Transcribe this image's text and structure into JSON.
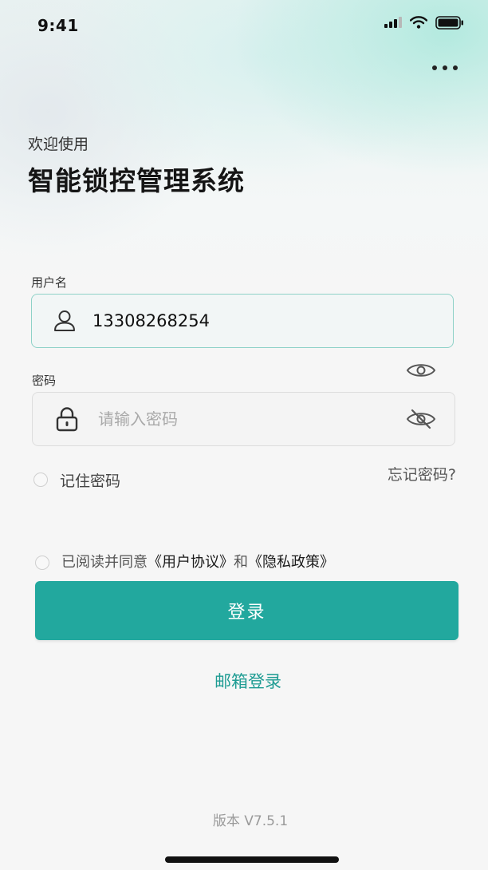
{
  "status_bar": {
    "time": "9:41",
    "icons": [
      "signal-icon",
      "wifi-icon",
      "battery-icon"
    ]
  },
  "header": {
    "more_icon": "more-horizontal-icon"
  },
  "welcome": {
    "subtitle": "欢迎使用",
    "title": "智能锁控管理系统"
  },
  "login_form": {
    "username": {
      "label": "用户名",
      "value": "13308268254",
      "icon": "user-icon"
    },
    "password": {
      "label": "密码",
      "value": "",
      "placeholder": "请输入密码",
      "icon": "lock-icon",
      "show_icon": "eye-icon",
      "hide_icon": "eye-off-icon"
    },
    "remember_label": "记住密码",
    "forgot_link": "忘记密码?",
    "agreement": {
      "prefix": "已阅读并同意",
      "user_agreement": "《用户协议》",
      "conjunction": "和",
      "privacy_policy": "《隐私政策》"
    },
    "login_button": "登录",
    "email_login": "邮箱登录"
  },
  "footer": {
    "version": "版本 V7.5.1"
  },
  "colors": {
    "primary": "#22a89e",
    "link": "#1f9c93",
    "focus_border": "#8fd2c8"
  }
}
